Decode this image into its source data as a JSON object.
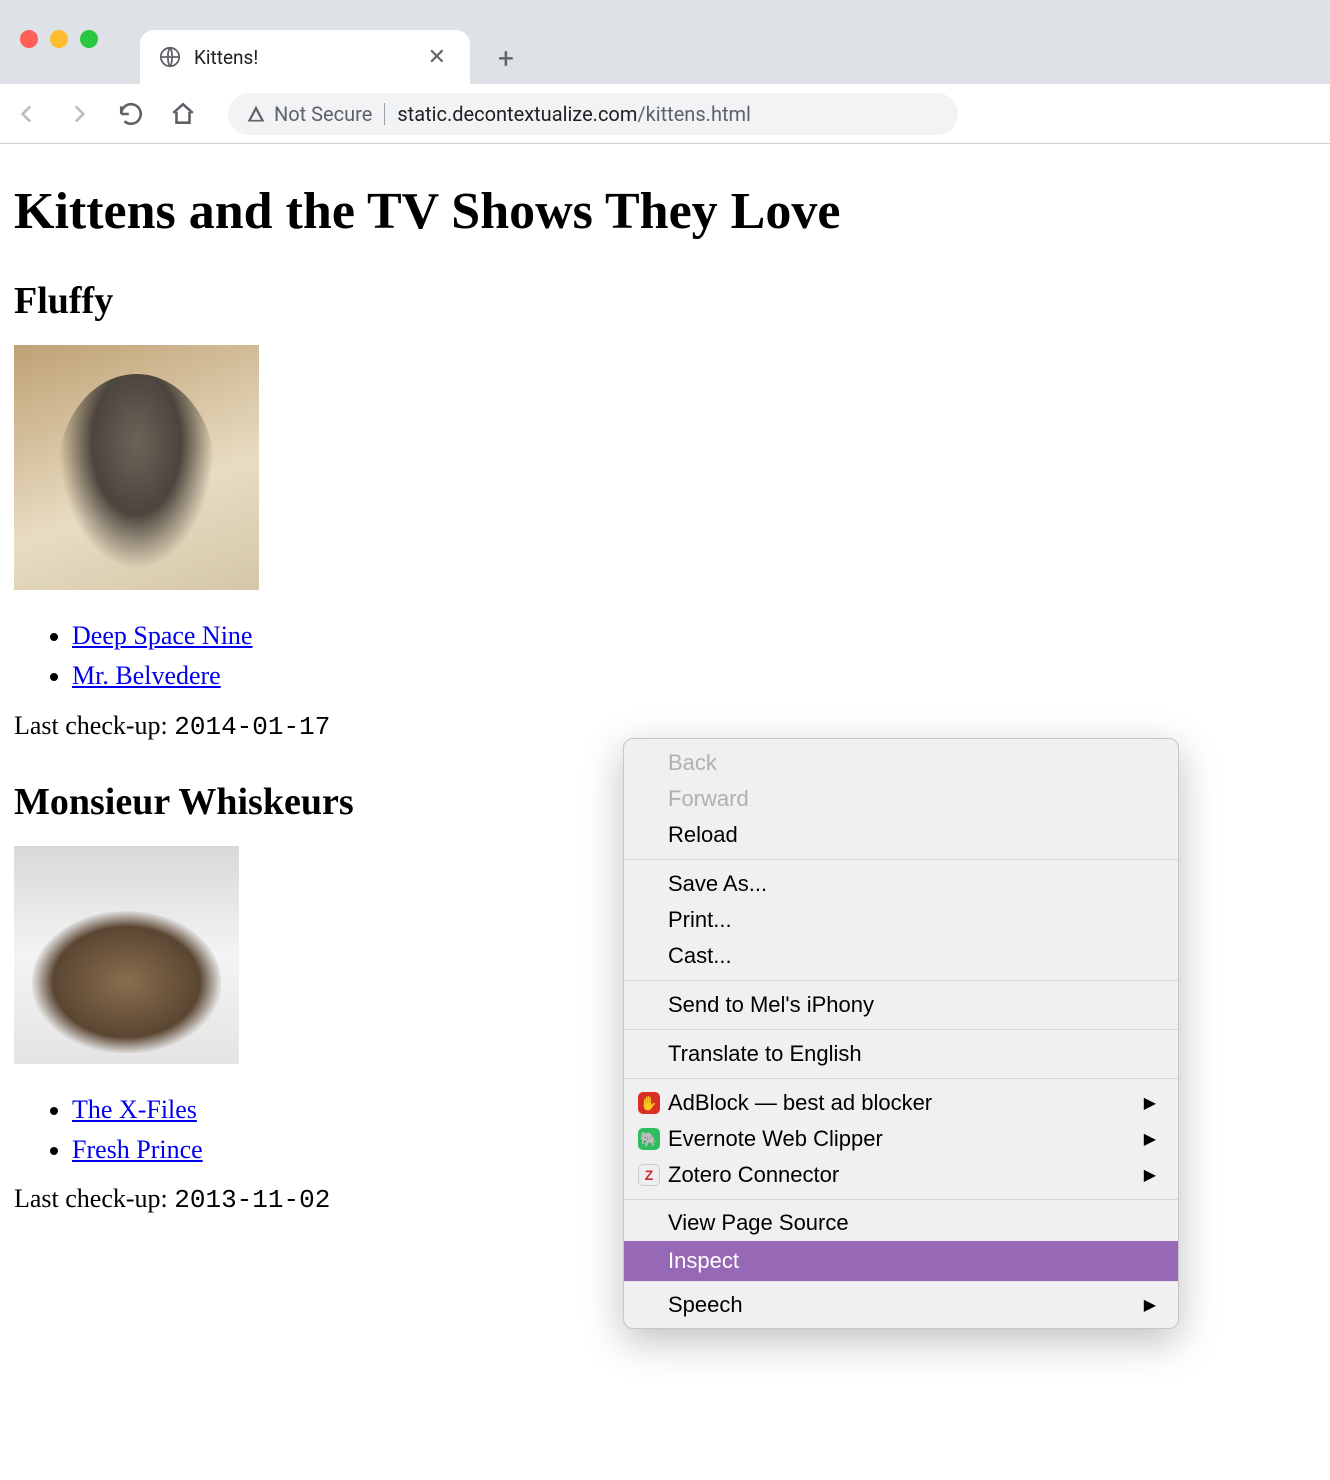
{
  "browser": {
    "tab_title": "Kittens!",
    "security_label": "Not Secure",
    "url_host": "static.decontextualize.com",
    "url_path": "/kittens.html"
  },
  "page": {
    "h1": "Kittens and the TV Shows They Love",
    "kittens": [
      {
        "name": "Fluffy",
        "shows": [
          "Deep Space Nine",
          "Mr. Belvedere"
        ],
        "checkup_label": "Last check-up: ",
        "checkup_date": "2014-01-17"
      },
      {
        "name": "Monsieur Whiskeurs",
        "shows": [
          "The X-Files",
          "Fresh Prince"
        ],
        "checkup_label": "Last check-up: ",
        "checkup_date": "2013-11-02"
      }
    ]
  },
  "context_menu": {
    "back": "Back",
    "forward": "Forward",
    "reload": "Reload",
    "save_as": "Save As...",
    "print": "Print...",
    "cast": "Cast...",
    "send_to": "Send to Mel's iPhony",
    "translate": "Translate to English",
    "adblock": "AdBlock — best ad blocker",
    "evernote": "Evernote Web Clipper",
    "zotero": "Zotero Connector",
    "view_source": "View Page Source",
    "inspect": "Inspect",
    "speech": "Speech"
  }
}
